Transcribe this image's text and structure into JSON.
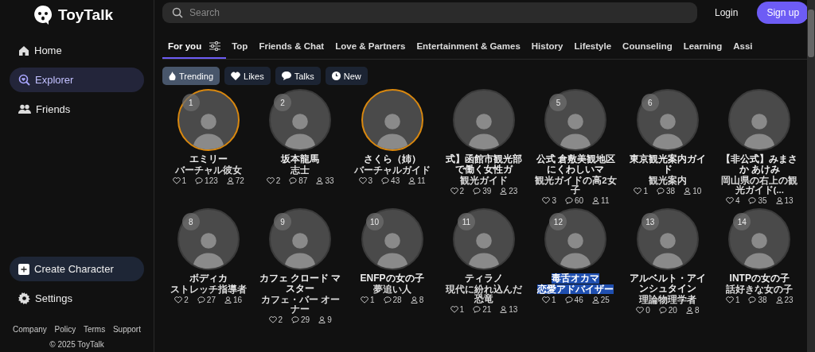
{
  "sidebar": {
    "logo": "ToyTalk",
    "nav": [
      {
        "label": "Home",
        "selected": false
      },
      {
        "label": "Explorer",
        "selected": true
      },
      {
        "label": "Friends",
        "selected": false
      }
    ],
    "create_button": "Create Character",
    "settings": "Settings",
    "footer_links": [
      "Company",
      "Policy",
      "Terms",
      "Support"
    ],
    "copyright": "© 2025 ToyTalk"
  },
  "search": {
    "placeholder": "Search"
  },
  "auth": {
    "login": "Login",
    "signup": "Sign up"
  },
  "tabs": [
    {
      "label": "For you",
      "selected": true
    },
    {
      "label": "Top",
      "selected": false
    },
    {
      "label": "Friends & Chat",
      "selected": false
    },
    {
      "label": "Love & Partners",
      "selected": false
    },
    {
      "label": "Entertainment & Games",
      "selected": false
    },
    {
      "label": "History",
      "selected": false
    },
    {
      "label": "Lifestyle",
      "selected": false
    },
    {
      "label": "Counseling",
      "selected": false
    },
    {
      "label": "Learning",
      "selected": false
    },
    {
      "label": "Assi",
      "selected": false
    }
  ],
  "sort_chips": [
    {
      "label": "Trending",
      "selected": true
    },
    {
      "label": "Likes",
      "selected": false
    },
    {
      "label": "Talks",
      "selected": false
    },
    {
      "label": "New",
      "selected": false
    }
  ],
  "characters": [
    {
      "rank": "1",
      "ring": true,
      "name": "エミリー",
      "role": "バーチャル彼女",
      "likes": "1",
      "talks": "123",
      "friends": "72",
      "text_selected": false
    },
    {
      "rank": "2",
      "ring": false,
      "name": "坂本龍馬",
      "role": "志士",
      "likes": "2",
      "talks": "87",
      "friends": "33",
      "text_selected": false
    },
    {
      "ring": true,
      "name": "さくら（姉）",
      "role": "バーチャルガイド",
      "likes": "3",
      "talks": "43",
      "friends": "11",
      "text_selected": false
    },
    {
      "ring": false,
      "name": "式】函館市観光部で働く女性ガ",
      "role": "観光ガイド",
      "likes": "2",
      "talks": "39",
      "friends": "23",
      "text_selected": false
    },
    {
      "rank": "5",
      "ring": false,
      "name": "公式 倉敷美観地区にくわしいマ",
      "role": "観光ガイドの高2女子",
      "likes": "3",
      "talks": "60",
      "friends": "11",
      "text_selected": false
    },
    {
      "rank": "6",
      "ring": false,
      "name": "東京観光案内ガイド",
      "role": "観光案内",
      "likes": "1",
      "talks": "38",
      "friends": "10",
      "text_selected": false
    },
    {
      "ring": false,
      "name": "【非公式】みまさか あけみ",
      "role": "岡山県の右上の観光ガイド(...",
      "likes": "4",
      "talks": "35",
      "friends": "13",
      "text_selected": false
    },
    {
      "rank": "8",
      "ring": false,
      "name": "ボディカ",
      "role": "ストレッチ指導者",
      "likes": "2",
      "talks": "27",
      "friends": "16",
      "text_selected": false
    },
    {
      "rank": "9",
      "ring": false,
      "name": "カフェ クロード マスター",
      "role": "カフェ・バー オーナー",
      "likes": "2",
      "talks": "29",
      "friends": "9",
      "text_selected": false
    },
    {
      "rank": "10",
      "ring": false,
      "name": "ENFPの女の子",
      "role": "夢追い人",
      "likes": "1",
      "talks": "28",
      "friends": "8",
      "text_selected": false
    },
    {
      "rank": "11",
      "ring": false,
      "name": "ティラノ",
      "role": "現代に紛れ込んだ恐竜",
      "likes": "1",
      "talks": "21",
      "friends": "13",
      "text_selected": false
    },
    {
      "rank": "12",
      "ring": false,
      "name": "毒舌オカマ",
      "role": "恋愛アドバイザー",
      "likes": "1",
      "talks": "46",
      "friends": "25",
      "text_selected": true
    },
    {
      "rank": "13",
      "ring": false,
      "name": "アルベルト・アインシュタイン",
      "role": "理論物理学者",
      "likes": "0",
      "talks": "20",
      "friends": "8",
      "text_selected": false
    },
    {
      "rank": "14",
      "ring": false,
      "name": "INTPの女の子",
      "role": "話好きな女の子",
      "likes": "1",
      "talks": "38",
      "friends": "23",
      "text_selected": false
    }
  ]
}
